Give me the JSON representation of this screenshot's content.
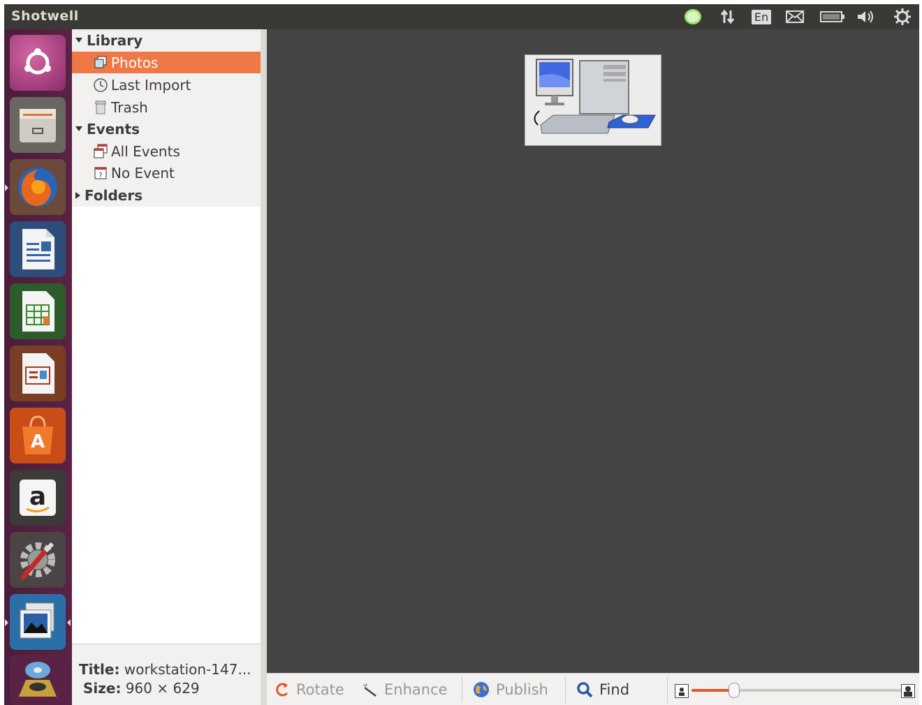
{
  "window": {
    "title": "Shotwell"
  },
  "tray": {
    "messaging": "messaging-icon",
    "network": "network-arrows-icon",
    "keyboard": "En",
    "mail": "mail-icon",
    "battery": "battery-icon",
    "volume": "volume-icon",
    "session": "gear-power-icon"
  },
  "launcher": [
    {
      "name": "ubuntu-dash"
    },
    {
      "name": "files"
    },
    {
      "name": "firefox"
    },
    {
      "name": "libreoffice-writer"
    },
    {
      "name": "libreoffice-calc"
    },
    {
      "name": "libreoffice-impress"
    },
    {
      "name": "software-center"
    },
    {
      "name": "amazon"
    },
    {
      "name": "system-settings"
    },
    {
      "name": "shotwell"
    },
    {
      "name": "disc"
    }
  ],
  "sidebar": {
    "library": "Library",
    "photos": "Photos",
    "last_import": "Last Import",
    "trash": "Trash",
    "events": "Events",
    "all_events": "All Events",
    "no_event": "No Event",
    "folders": "Folders"
  },
  "info": {
    "title_label": "Title:",
    "title_value": "workstation-147...",
    "size_label": "Size:",
    "size_value": "960 × 629"
  },
  "toolbar": {
    "rotate": "Rotate",
    "enhance": "Enhance",
    "publish": "Publish",
    "find": "Find",
    "zoom_level": 0.2
  },
  "colors": {
    "selection": "#f07746",
    "launcher": "#5a2345",
    "viewer_bg": "#444444"
  }
}
